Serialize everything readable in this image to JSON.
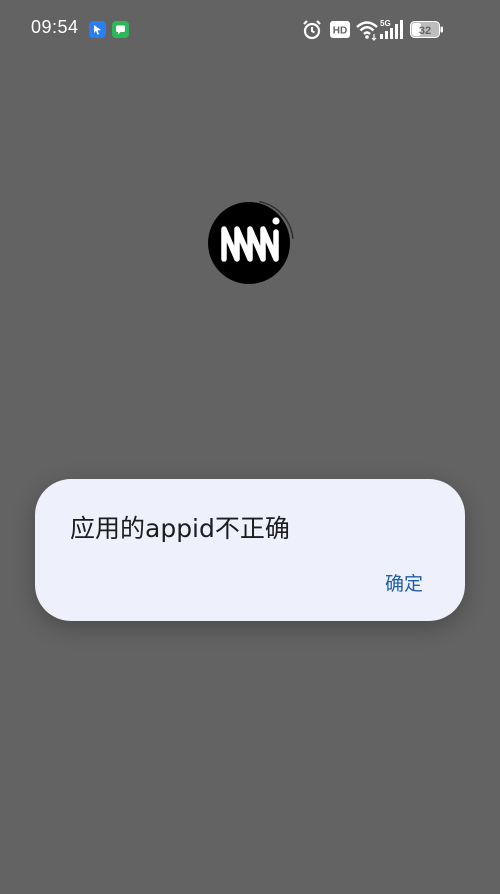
{
  "status_bar": {
    "time": "09:54",
    "battery_level": "32",
    "network_label": "5G",
    "hd_label": "HD"
  },
  "dialog": {
    "message": "应用的appid不正确",
    "confirm_label": "确定"
  },
  "colors": {
    "background": "#636363",
    "dialog_background": "#eef0fb",
    "accent": "#1f5fa6"
  }
}
